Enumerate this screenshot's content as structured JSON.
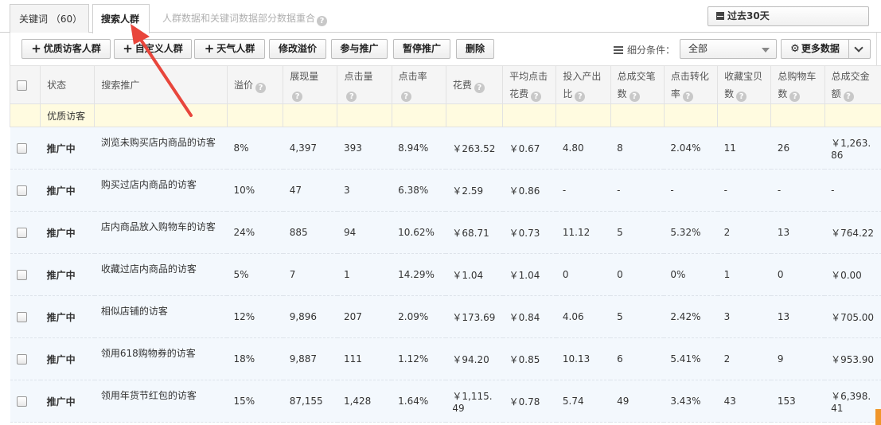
{
  "tabs": [
    {
      "label": "关键词 （60）"
    },
    {
      "label": "搜索人群"
    }
  ],
  "tab_hint": "人群数据和关键词数据部分数据重合",
  "date_range": {
    "label": "过去30天"
  },
  "toolbar": {
    "add_quality": "优质访客人群",
    "add_custom": "自定义人群",
    "add_weather": "天气人群",
    "modify_premium": "修改溢价",
    "join_promo": "参与推广",
    "pause_promo": "暂停推广",
    "delete": "删除",
    "filter_label": "细分条件：",
    "filter_value": "全部",
    "more_data": "更多数据"
  },
  "columns": {
    "status": "状态",
    "name": "搜索推广",
    "premium": "溢价",
    "impressions": "展现量",
    "clicks": "点击量",
    "ctr": "点击率",
    "cost": "花费",
    "avg_cpc_1": "平均点击",
    "avg_cpc_2": "花费",
    "roi_1": "投入产出",
    "roi_2": "比",
    "deals_1": "总成交笔",
    "deals_2": "数",
    "cvr_1": "点击转化",
    "cvr_2": "率",
    "fav_1": "收藏宝贝",
    "fav_2": "数",
    "cart_1": "总购物车",
    "cart_2": "数",
    "gmv_1": "总成交金",
    "gmv_2": "额"
  },
  "group_label": "优质访客",
  "rows": [
    {
      "status": "推广中",
      "name": "浏览未购买店内商品的访客",
      "premium": "8%",
      "impressions": "4,397",
      "clicks": "393",
      "ctr": "8.94%",
      "cost": "￥263.52",
      "cpc": "￥0.67",
      "roi": "4.80",
      "deals": "8",
      "cvr": "2.04%",
      "fav": "11",
      "cart": "26",
      "gmv": "￥1,263.86"
    },
    {
      "status": "推广中",
      "name": "购买过店内商品的访客",
      "premium": "10%",
      "impressions": "47",
      "clicks": "3",
      "ctr": "6.38%",
      "cost": "￥2.59",
      "cpc": "￥0.86",
      "roi": "-",
      "deals": "-",
      "cvr": "-",
      "fav": "-",
      "cart": "-",
      "gmv": "-"
    },
    {
      "status": "推广中",
      "name": "店内商品放入购物车的访客",
      "premium": "24%",
      "impressions": "885",
      "clicks": "94",
      "ctr": "10.62%",
      "cost": "￥68.71",
      "cpc": "￥0.73",
      "roi": "11.12",
      "deals": "5",
      "cvr": "5.32%",
      "fav": "2",
      "cart": "13",
      "gmv": "￥764.22"
    },
    {
      "status": "推广中",
      "name": "收藏过店内商品的访客",
      "premium": "5%",
      "impressions": "7",
      "clicks": "1",
      "ctr": "14.29%",
      "cost": "￥1.04",
      "cpc": "￥1.04",
      "roi": "0",
      "deals": "0",
      "cvr": "0%",
      "fav": "1",
      "cart": "0",
      "gmv": "￥0.00"
    },
    {
      "status": "推广中",
      "name": "相似店铺的访客",
      "premium": "12%",
      "impressions": "9,896",
      "clicks": "207",
      "ctr": "2.09%",
      "cost": "￥173.69",
      "cpc": "￥0.84",
      "roi": "4.06",
      "deals": "5",
      "cvr": "2.42%",
      "fav": "3",
      "cart": "13",
      "gmv": "￥705.00"
    },
    {
      "status": "推广中",
      "name": "领用618购物券的访客",
      "premium": "18%",
      "impressions": "9,887",
      "clicks": "111",
      "ctr": "1.12%",
      "cost": "￥94.20",
      "cpc": "￥0.85",
      "roi": "10.13",
      "deals": "6",
      "cvr": "5.41%",
      "fav": "2",
      "cart": "9",
      "gmv": "￥953.90"
    },
    {
      "status": "推广中",
      "name": "领用年货节红包的访客",
      "premium": "15%",
      "impressions": "87,155",
      "clicks": "1,428",
      "ctr": "1.64%",
      "cost": "￥1,115.49",
      "cpc": "￥0.78",
      "roi": "5.74",
      "deals": "49",
      "cvr": "3.43%",
      "fav": "43",
      "cart": "153",
      "gmv": "￥6,398.41"
    }
  ],
  "colors": {
    "status_green": "#2e9b2e",
    "arrow_red": "#e8463c",
    "row_bg": "#f3f8fd",
    "group_bg": "#fffbe0"
  }
}
